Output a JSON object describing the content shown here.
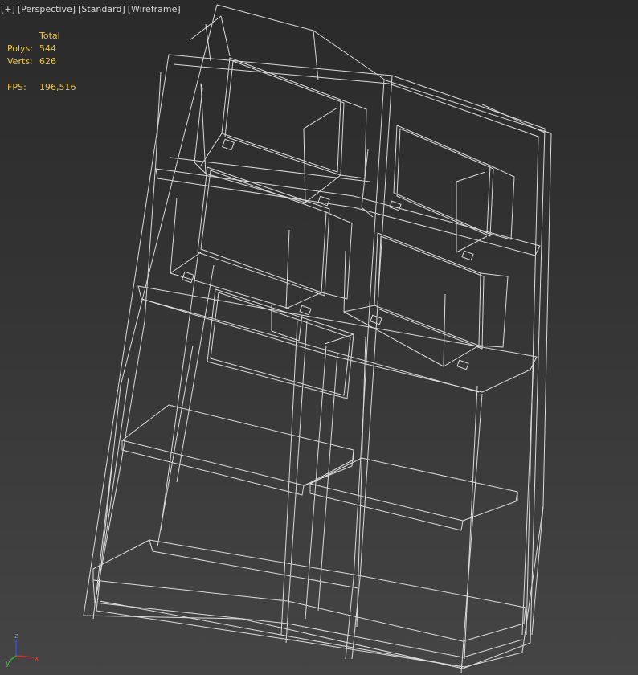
{
  "viewport": {
    "labels": [
      "[+]",
      "[Perspective]",
      "[Standard]",
      "[Wireframe]"
    ]
  },
  "stats": {
    "header": "Total",
    "polys_label": "Polys:",
    "polys_value": "544",
    "verts_label": "Verts:",
    "verts_value": "626",
    "fps_label": "FPS:",
    "fps_value": "196,516"
  },
  "axis": {
    "z": "z",
    "y": "y",
    "x": "x"
  },
  "colors": {
    "wire": "#ececec",
    "stats": "#e8c34a",
    "label": "#d8d8d8",
    "axis_x": "#d03030",
    "axis_y": "#30b030",
    "axis_z": "#3050e0"
  }
}
